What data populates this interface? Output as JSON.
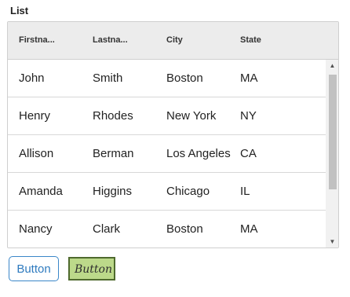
{
  "list": {
    "title": "List",
    "columns": [
      "Firstna...",
      "Lastna...",
      "City",
      "State"
    ],
    "rows": [
      [
        "John",
        "Smith",
        "Boston",
        "MA"
      ],
      [
        "Henry",
        "Rhodes",
        "New York",
        "NY"
      ],
      [
        "Allison",
        "Berman",
        "Los Angeles",
        "CA"
      ],
      [
        "Amanda",
        "Higgins",
        "Chicago",
        "IL"
      ],
      [
        "Nancy",
        "Clark",
        "Boston",
        "MA"
      ]
    ]
  },
  "scrollbar": {
    "up_icon": "chevron-up-icon",
    "down_icon": "chevron-down-icon"
  },
  "buttons": {
    "primary_label": "Button",
    "secondary_label": "Button"
  },
  "colors": {
    "header_bg": "#ececec",
    "primary_button_border": "#3a87c9",
    "secondary_button_bg": "#bcd98a",
    "secondary_button_border": "#4f6a2e"
  }
}
